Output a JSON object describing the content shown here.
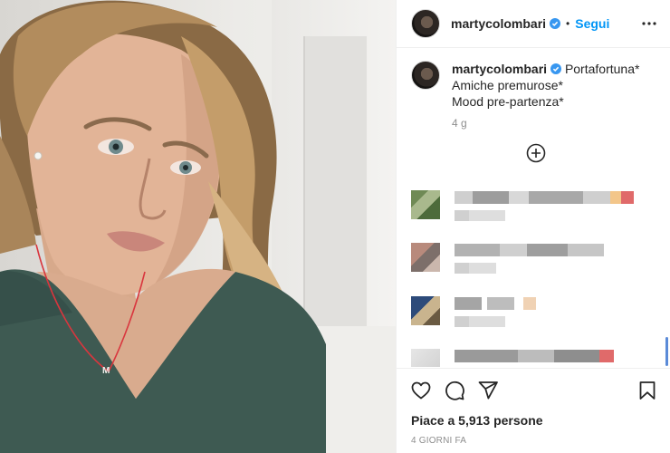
{
  "post": {
    "username": "martycolombari",
    "follow_label": "Segui",
    "separator": "•",
    "caption_lines": [
      "Portafortuna*",
      "Amiche premurose*",
      "Mood pre-partenza*"
    ],
    "caption_time": "4 g",
    "likes_text": "Piace a 5,913 persone",
    "posted_ago": "4 GIORNI FA",
    "pendant_letter": "M"
  },
  "icons": {
    "more": "more-options-icon",
    "verified": "verified-badge-icon",
    "add": "add-comment-plus-icon",
    "like": "heart-icon",
    "comment": "comment-bubble-icon",
    "share": "paper-plane-icon",
    "save": "bookmark-icon"
  },
  "colors": {
    "accent": "#0095f6",
    "text": "#262626",
    "muted": "#8e8e8e",
    "border": "#efefef"
  }
}
